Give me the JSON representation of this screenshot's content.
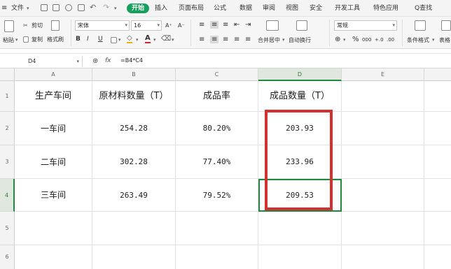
{
  "menu": {
    "file": "文件",
    "tabs": [
      "开始",
      "插入",
      "页面布局",
      "公式",
      "数据",
      "审阅",
      "视图",
      "安全",
      "开发工具",
      "特色应用"
    ],
    "active_tab": "开始",
    "search": "Q查找"
  },
  "ribbon": {
    "paste": "粘贴",
    "cut": "剪切",
    "copy": "复制",
    "format_painter": "格式刷",
    "font_name": "宋体",
    "font_size": "16",
    "bold": "B",
    "italic": "I",
    "underline": "U",
    "font_color_glyph": "A",
    "grow_font": "A⁺",
    "shrink_font": "A⁻",
    "merge_center": "合并居中",
    "wrap_text": "自动换行",
    "number_format": "常规",
    "percent": "%",
    "thousands": "000",
    "inc_decimal": "+.0",
    "dec_decimal": ".00",
    "conditional_format": "条件格式",
    "table_style": "表格"
  },
  "formula_bar": {
    "name_box": "D4",
    "fx": "fx",
    "formula": "=B4*C4"
  },
  "sheet": {
    "columns": [
      "A",
      "B",
      "C",
      "D",
      "E"
    ],
    "rows": [
      "1",
      "2",
      "3",
      "4",
      "5",
      "6"
    ],
    "header": [
      "生产车间",
      "原材料数量（T）",
      "成品率",
      "成品数量（T）"
    ],
    "data": [
      [
        "一车间",
        "254.28",
        "80.20%",
        "203.93"
      ],
      [
        "二车间",
        "302.28",
        "77.40%",
        "233.96"
      ],
      [
        "三车间",
        "263.49",
        "79.52%",
        "209.53"
      ]
    ]
  },
  "colors": {
    "accent_green": "#17a05d",
    "selection_green": "#1e8a3e",
    "highlight_red": "#d4302f"
  }
}
